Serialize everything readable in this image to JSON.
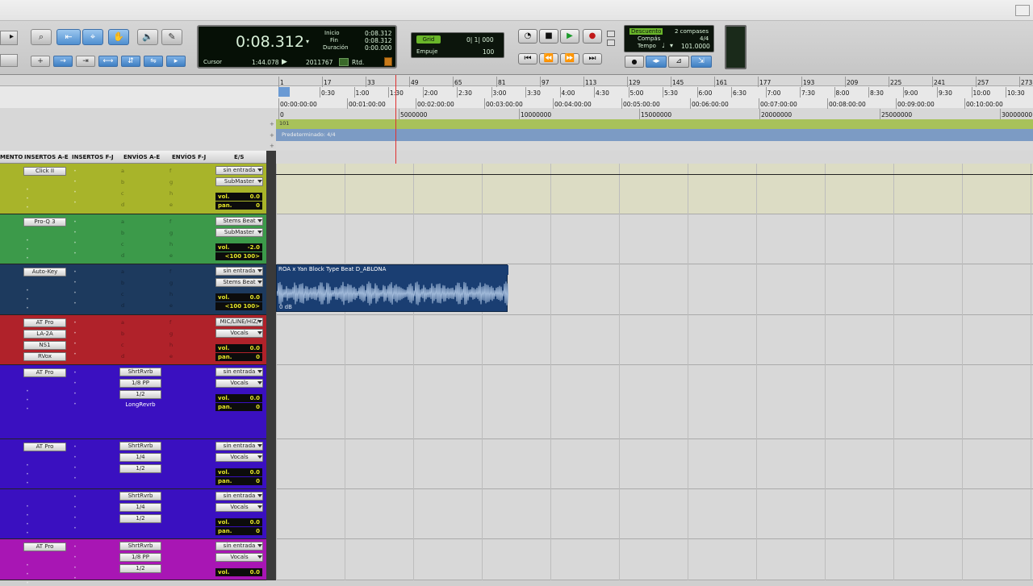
{
  "toolbar": {
    "edit_modes": [
      "Shuffle",
      "Slip",
      "Spot",
      "Grid"
    ],
    "tools": [
      "zoom",
      "trim",
      "select",
      "grab",
      "scrub",
      "pencil"
    ]
  },
  "counter": {
    "main_time": "0:08.312",
    "labels": {
      "start": "Inicio",
      "end": "Fin",
      "length": "Duración",
      "cursor": "Cursor"
    },
    "start_value": "0:08.312",
    "end_value": "0:08.312",
    "length_value": "0:00.000",
    "cursor_time": "1:44.078",
    "cursor_samples": "2011767",
    "rtd": "Rtd."
  },
  "grid": {
    "grid_label": "Grid",
    "grid_value": "0| 1| 000",
    "nudge_label": "Empuje",
    "nudge_value": "100"
  },
  "meter": {
    "countoff": "Descuento",
    "countoff_value": "2 compases",
    "meter_label": "Compás",
    "meter_value": "4/4",
    "tempo_label": "Tempo",
    "tempo_value": "101.0000"
  },
  "ruler": {
    "bars": [
      "1",
      "17",
      "33",
      "49",
      "65",
      "81",
      "97",
      "113",
      "129",
      "145",
      "161",
      "177",
      "193",
      "209",
      "225",
      "241",
      "257",
      "273"
    ],
    "minsecs": [
      "0:30",
      "1:00",
      "1:30",
      "2:00",
      "2:30",
      "3:00",
      "3:30",
      "4:00",
      "4:30",
      "5:00",
      "5:30",
      "6:00",
      "6:30",
      "7:00",
      "7:30",
      "8:00",
      "8:30",
      "9:00",
      "9:30",
      "10:00",
      "10:30"
    ],
    "timecode": [
      "00:00:00:00",
      "00:01:00:00",
      "00:02:00:00",
      "00:03:00:00",
      "00:04:00:00",
      "00:05:00:00",
      "00:06:00:00",
      "00:07:00:00",
      "00:08:00:00",
      "00:09:00:00",
      "00:10:00:00"
    ],
    "samples": [
      "0",
      "5000000",
      "10000000",
      "15000000",
      "20000000",
      "25000000",
      "30000000"
    ],
    "tempo_marker": "101",
    "meter_marker": "Predeterminado: 4/4"
  },
  "columns": [
    "MENTO",
    "INSERTOS A-E",
    "INSERTOS F-J",
    "ENVÍOS A-E",
    "ENVÍOS F-J",
    "E/S"
  ],
  "tracks": [
    {
      "color": "#a8b42a",
      "ins_a": [
        "Click II"
      ],
      "sends_a": [
        "a",
        "b",
        "c",
        "d"
      ],
      "sends_f": [
        "f",
        "g",
        "h",
        "e"
      ],
      "input": "sin entrada",
      "output": "SubMaster",
      "vol": "0.0",
      "pan": "0",
      "pan_label": "pan."
    },
    {
      "color": "#3c9a4a",
      "ins_a": [
        "Pro-Q 3"
      ],
      "sends_a": [
        "a",
        "b",
        "c",
        "d"
      ],
      "sends_f": [
        "f",
        "g",
        "h",
        "e"
      ],
      "input": "Stems Beat",
      "output": "SubMaster",
      "vol": "-2.0",
      "pan": "<100 100>",
      "pan_label": ""
    },
    {
      "color": "#1d3a5e",
      "ins_a": [
        "Auto-Key"
      ],
      "sends_a": [
        "a",
        "b",
        "c",
        "d"
      ],
      "sends_f": [
        "f",
        "g",
        "h",
        "e"
      ],
      "input": "sin entrada",
      "output": "Stems Beat",
      "vol": "0.0",
      "pan": "<100 100>",
      "pan_label": ""
    },
    {
      "color": "#b0222a",
      "ins_a": [
        "AT Pro",
        "LA-2A",
        "NS1",
        "RVox"
      ],
      "sends_a": [
        "a",
        "b",
        "c",
        "d"
      ],
      "sends_f": [
        "f",
        "g",
        "h",
        "e"
      ],
      "input": "MIC/LINE/HIZ/",
      "output": "Vocals",
      "vol": "0.0",
      "pan": "0",
      "pan_label": "pan."
    },
    {
      "color": "#3a10c0",
      "ins_a": [
        "AT Pro"
      ],
      "sends_list": [
        "ShrtRvrb",
        "1/8 PP",
        "1/2",
        "LongRevrb"
      ],
      "input": "sin entrada",
      "output": "Vocals",
      "vol": "0.0",
      "pan": "0",
      "pan_label": "pan."
    },
    {
      "color": "#3a10c0",
      "ins_a": [
        "AT Pro"
      ],
      "sends_list": [
        "ShrtRvrb",
        "1/4",
        "1/2"
      ],
      "input": "sin entrada",
      "output": "Vocals",
      "vol": "0.0",
      "pan": "0",
      "pan_label": "pan."
    },
    {
      "color": "#3a10c0",
      "ins_a": [],
      "sends_list": [
        "ShrtRvrb",
        "1/4",
        "1/2"
      ],
      "input": "sin entrada",
      "output": "Vocals",
      "vol": "0.0",
      "pan": "0",
      "pan_label": "pan."
    },
    {
      "color": "#a816b4",
      "ins_a": [
        "AT Pro"
      ],
      "sends_list": [
        "ShrtRvrb",
        "1/8 PP",
        "1/2"
      ],
      "input": "sin entrada",
      "output": "Vocals",
      "vol": "0.0",
      "pan": "",
      "pan_label": ""
    }
  ],
  "labels": {
    "vol": "vol.",
    "pan": "pan."
  },
  "clip": {
    "name": "ROA x Yan Block Type Beat D_ABLONA",
    "gain": "0 dB"
  }
}
